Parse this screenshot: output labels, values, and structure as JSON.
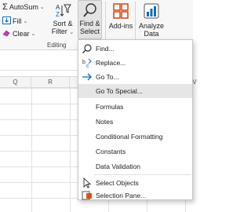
{
  "ribbon": {
    "autosum": "AutoSum",
    "fill": "Fill",
    "clear": "Clear",
    "sort_filter": [
      "Sort &",
      "Filter"
    ],
    "find_select": [
      "Find &",
      "Select"
    ],
    "addins": "Add-ins",
    "analyze": [
      "Analyze",
      "Data"
    ],
    "group_editing": "Editing"
  },
  "columns": [
    "Q",
    "R",
    "V"
  ],
  "menu": {
    "items": [
      {
        "label": "Find...",
        "icon": "search-icon"
      },
      {
        "label": "Replace...",
        "icon": "replace-icon"
      },
      {
        "label": "Go To...",
        "icon": "arrow-right-icon"
      },
      {
        "label": "Go To Special...",
        "icon": ""
      },
      {
        "label": "Formulas",
        "icon": ""
      },
      {
        "label": "Notes",
        "icon": ""
      },
      {
        "label": "Conditional Formatting",
        "icon": ""
      },
      {
        "label": "Constants",
        "icon": ""
      },
      {
        "label": "Data Validation",
        "icon": ""
      },
      {
        "label": "Select Objects",
        "icon": "cursor-icon"
      },
      {
        "label": "Selection Pane...",
        "icon": "selection-pane-icon"
      }
    ]
  },
  "colors": {
    "accent": "#0f6cbd",
    "highlight": "#e6e6e6",
    "addins_red": "#d83b01"
  }
}
